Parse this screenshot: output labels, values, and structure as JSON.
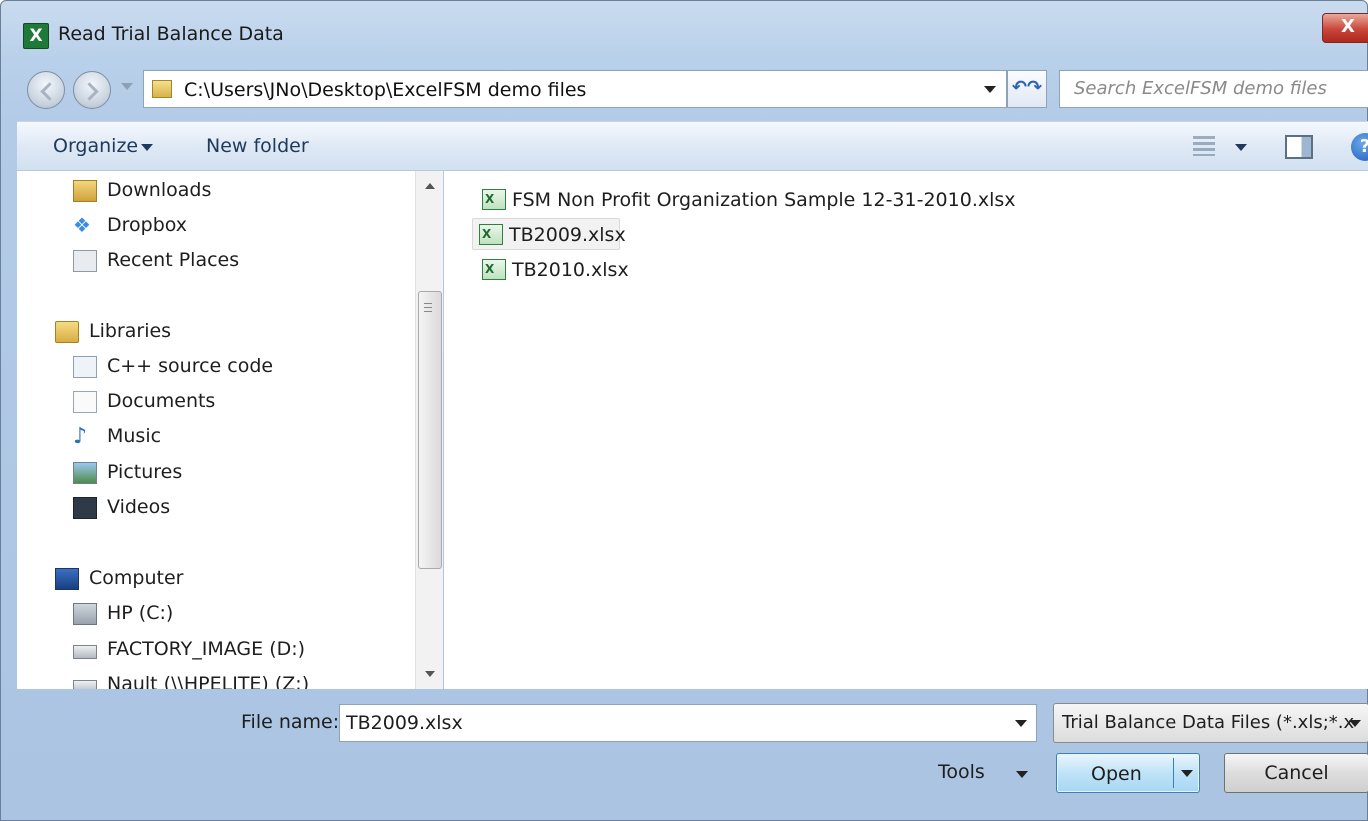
{
  "window": {
    "title": "Read Trial Balance Data",
    "close_label": "X"
  },
  "navigation": {
    "address": "C:\\Users\\JNo\\Desktop\\ExcelFSM demo files",
    "search_placeholder": "Search ExcelFSM demo files",
    "refresh_symbol": "↶↷"
  },
  "toolbar": {
    "organize_label": "Organize",
    "new_folder_label": "New folder",
    "help_symbol": "?"
  },
  "nav_pane": {
    "favorites": [
      {
        "label": "Downloads",
        "icon": "downloads-icon"
      },
      {
        "label": "Dropbox",
        "icon": "dropbox-icon"
      },
      {
        "label": "Recent Places",
        "icon": "recent-places-icon"
      }
    ],
    "libraries_label": "Libraries",
    "libraries": [
      {
        "label": "C++ source code",
        "icon": "library-icon"
      },
      {
        "label": "Documents",
        "icon": "documents-icon"
      },
      {
        "label": "Music",
        "icon": "music-icon"
      },
      {
        "label": "Pictures",
        "icon": "pictures-icon"
      },
      {
        "label": "Videos",
        "icon": "videos-icon"
      }
    ],
    "computer_label": "Computer",
    "drives": [
      {
        "label": "HP (C:)",
        "icon": "hard-drive-icon",
        "selected": true
      },
      {
        "label": "FACTORY_IMAGE (D:)",
        "icon": "drive-icon"
      },
      {
        "label": "Nault (\\\\HPELITE) (Z:)",
        "icon": "network-drive-icon"
      }
    ],
    "dropbox_glyph": "❖",
    "music_glyph": "♪"
  },
  "files": [
    {
      "name": "FSM Non Profit Organization Sample 12-31-2010.xlsx",
      "icon": "excel-file-icon",
      "selected": false
    },
    {
      "name": "TB2009.xlsx",
      "icon": "excel-file-icon",
      "selected": true
    },
    {
      "name": "TB2010.xlsx",
      "icon": "excel-file-icon",
      "selected": false
    }
  ],
  "footer": {
    "file_name_label": "File name:",
    "file_name_value": "TB2009.xlsx",
    "file_type_value": "Trial Balance Data Files (*.xls;*.x",
    "tools_label": "Tools",
    "open_label": "Open",
    "cancel_label": "Cancel"
  }
}
